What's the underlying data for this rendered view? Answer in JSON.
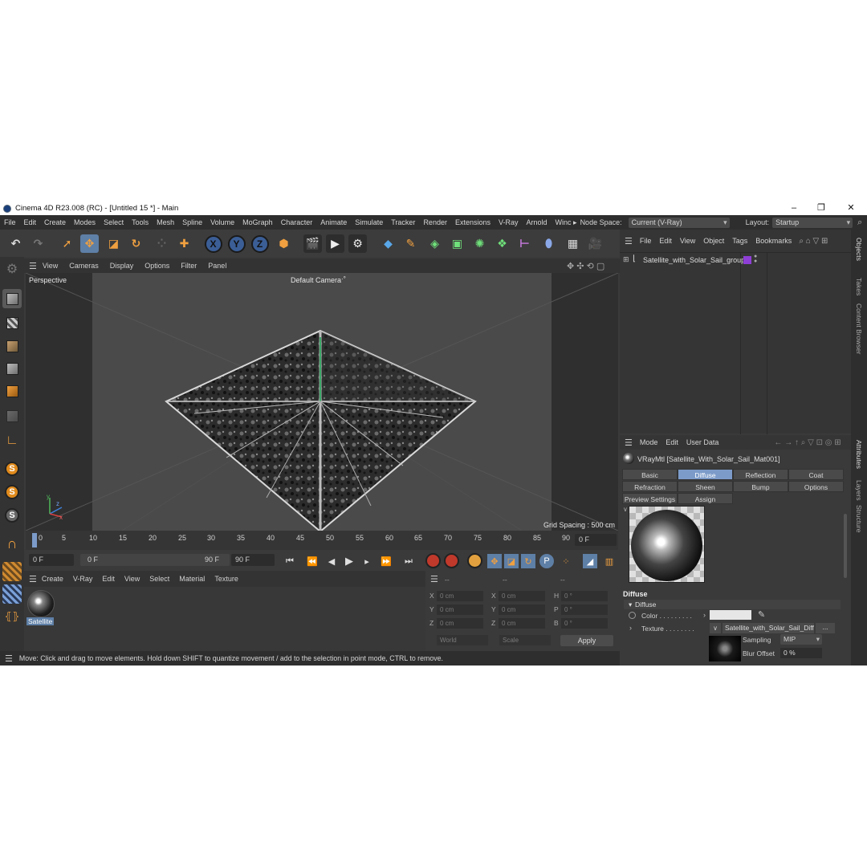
{
  "window": {
    "title": "Cinema 4D R23.008 (RC) - [Untitled 15 *] - Main",
    "minimize": "–",
    "maximize": "❐",
    "close": "✕"
  },
  "menubar": {
    "items": [
      "File",
      "Edit",
      "Create",
      "Modes",
      "Select",
      "Tools",
      "Mesh",
      "Spline",
      "Volume",
      "MoGraph",
      "Character",
      "Animate",
      "Simulate",
      "Tracker",
      "Render",
      "Extensions",
      "V-Ray",
      "Arnold",
      "Winc ▸"
    ],
    "node_space_label": "Node Space:",
    "node_space_value": "Current (V-Ray)",
    "layout_label": "Layout:",
    "layout_value": "Startup"
  },
  "viewport": {
    "menu": [
      "View",
      "Cameras",
      "Display",
      "Options",
      "Filter",
      "Panel"
    ],
    "name": "Perspective",
    "camera": "Default Camera",
    "camera_suffix": "·°",
    "grid_spacing": "Grid Spacing : 500 cm",
    "axis_y": "y",
    "axis_z": "z",
    "axis_x": "x"
  },
  "timeline": {
    "ticks": [
      "0",
      "5",
      "10",
      "15",
      "20",
      "25",
      "30",
      "35",
      "40",
      "45",
      "50",
      "55",
      "60",
      "65",
      "70",
      "75",
      "80",
      "85",
      "90"
    ],
    "current_frame_right": "0 F",
    "start_frame": "0 F",
    "range_start": "0 F",
    "range_end": "90 F",
    "end_frame": "90 F"
  },
  "material_manager": {
    "menu": [
      "Create",
      "V-Ray",
      "Edit",
      "View",
      "Select",
      "Material",
      "Texture"
    ],
    "material_name": "Satellite"
  },
  "coordinates": {
    "header": [
      "--",
      "--",
      "--"
    ],
    "rows": [
      {
        "l1": "X",
        "v1": "0 cm",
        "l2": "X",
        "v2": "0 cm",
        "l3": "H",
        "v3": "0 °"
      },
      {
        "l1": "Y",
        "v1": "0 cm",
        "l2": "Y",
        "v2": "0 cm",
        "l3": "P",
        "v3": "0 °"
      },
      {
        "l1": "Z",
        "v1": "0 cm",
        "l2": "Z",
        "v2": "0 cm",
        "l3": "B",
        "v3": "0 °"
      }
    ],
    "world": "World",
    "scale": "Scale",
    "apply": "Apply"
  },
  "status": {
    "text": "Move: Click and drag to move elements. Hold down SHIFT to quantize movement / add to the selection in point mode, CTRL to remove."
  },
  "object_manager": {
    "menu": [
      "File",
      "Edit",
      "View",
      "Object",
      "Tags",
      "Bookmarks"
    ],
    "object_name": "Satellite_with_Solar_Sail_group"
  },
  "side_tabs": {
    "top": [
      "Objects",
      "Takes",
      "Content Browser"
    ],
    "bottom": [
      "Attributes",
      "Layers",
      "Structure"
    ]
  },
  "attributes": {
    "menu": [
      "Mode",
      "Edit",
      "User Data"
    ],
    "title": "VRayMtl [Satellite_With_Solar_Sail_Mat001]",
    "tabs_row1": [
      "Basic",
      "Diffuse",
      "Reflection",
      "Coat"
    ],
    "tabs_row2": [
      "Refraction",
      "Sheen",
      "Bump",
      "Options"
    ],
    "tabs_row3": [
      "Preview Settings",
      "Assign"
    ],
    "active_tab": "Diffuse",
    "section_title": "Diffuse",
    "group_title": "Diffuse",
    "color_label": "Color . . . . . . . . .",
    "texture_label": "Texture . . . . . . . .",
    "texture_name": "Satellite_with_Solar_Sail_Diff",
    "texture_more": "...",
    "sampling_label": "Sampling",
    "sampling_value": "MIP",
    "blur_label": "Blur Offset",
    "blur_value": "0 %"
  },
  "colors": {
    "accent": "#7c9bc9",
    "selected_tool": "#5e7fa6",
    "orange": "#e08a1c",
    "tag_purple": "#8e3fd6",
    "bg": "#3a3a3a"
  }
}
